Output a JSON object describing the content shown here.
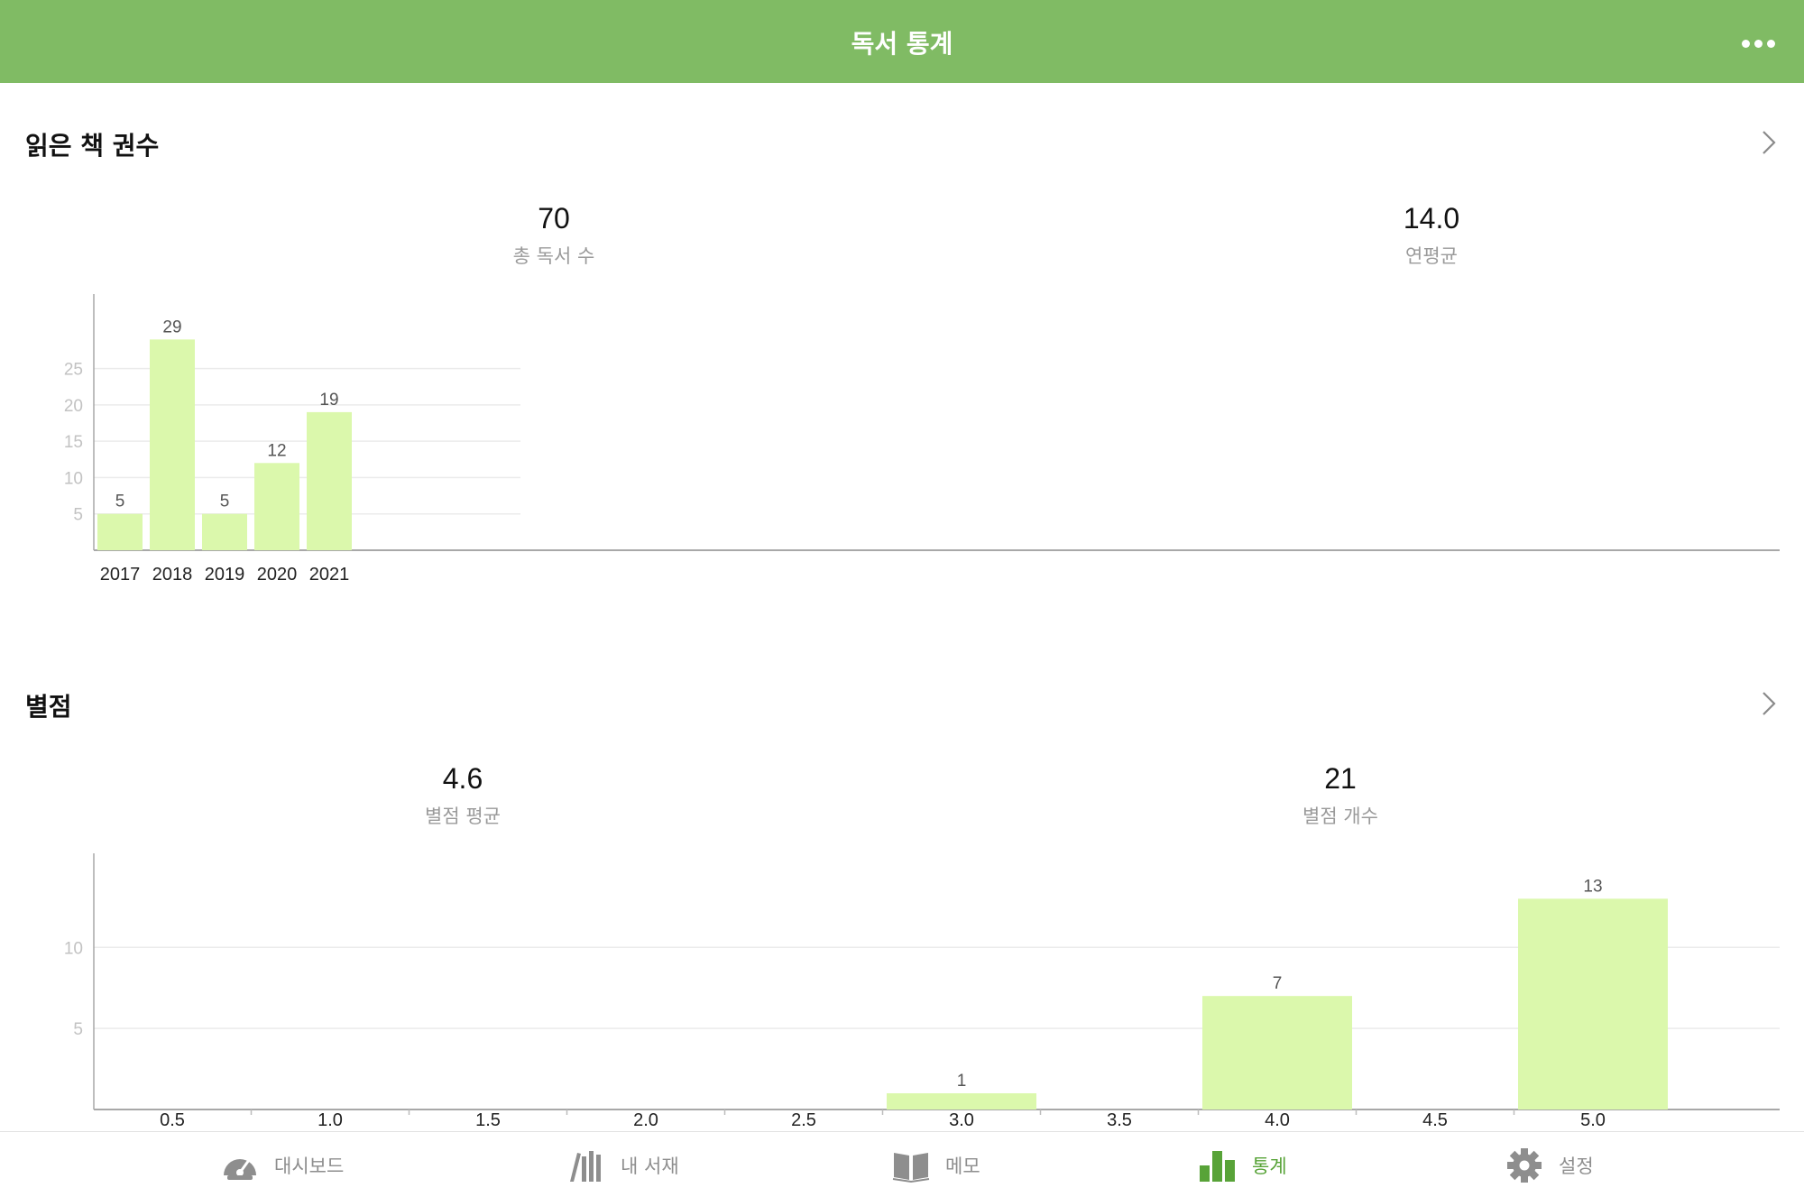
{
  "header": {
    "title": "독서 통계",
    "more_icon": "ellipsis-icon"
  },
  "accent_color": "#80bb64",
  "bar_color": "#dbf8ac",
  "books_section": {
    "title": "읽은 책 권수",
    "stats": [
      {
        "value": "70",
        "label": "총 독서 수"
      },
      {
        "value": "14.0",
        "label": "연평균"
      }
    ]
  },
  "rating_section": {
    "title": "별점",
    "stats": [
      {
        "value": "4.6",
        "label": "별점 평균"
      },
      {
        "value": "21",
        "label": "별점 개수"
      }
    ]
  },
  "chart_data": [
    {
      "type": "bar",
      "categories": [
        "2017",
        "2018",
        "2019",
        "2020",
        "2021"
      ],
      "values": [
        5,
        29,
        5,
        12,
        19
      ],
      "yticks": [
        "5",
        "10",
        "15",
        "20",
        "25"
      ],
      "ylim": [
        0,
        35
      ],
      "grid": true,
      "title": "",
      "xlabel": "",
      "ylabel": ""
    },
    {
      "type": "bar",
      "categories": [
        "0.5",
        "1.0",
        "1.5",
        "2.0",
        "2.5",
        "3.0",
        "3.5",
        "4.0",
        "4.5",
        "5.0"
      ],
      "values": [
        0,
        0,
        0,
        0,
        0,
        1,
        0,
        7,
        0,
        13
      ],
      "yticks": [
        "5",
        "10"
      ],
      "ylim": [
        0,
        15.8
      ],
      "grid": true,
      "title": "",
      "xlabel": "",
      "ylabel": ""
    }
  ],
  "tabs": [
    {
      "label": "대시보드",
      "icon": "speedometer-icon",
      "active": false
    },
    {
      "label": "내 서재",
      "icon": "bookshelf-icon",
      "active": false
    },
    {
      "label": "메모",
      "icon": "open-book-icon",
      "active": false
    },
    {
      "label": "통계",
      "icon": "bar-chart-icon",
      "active": true
    },
    {
      "label": "설정",
      "icon": "gear-icon",
      "active": false
    }
  ]
}
